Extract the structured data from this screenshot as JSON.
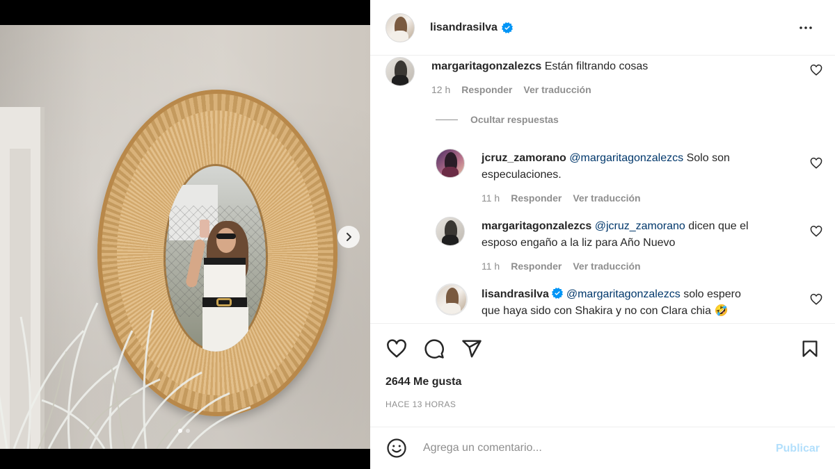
{
  "post": {
    "author": "lisandrasilva",
    "verified": true,
    "carousel": {
      "current_slide": 1,
      "total_slides": 2
    }
  },
  "comments": [
    {
      "username": "margaritagonzalezcs",
      "text": "Están filtrando cosas",
      "time": "12 h",
      "reply_label": "Responder",
      "translate_label": "Ver traducción"
    }
  ],
  "replies_toggle": "Ocultar respuestas",
  "replies": [
    {
      "username": "jcruz_zamorano",
      "mention": "@margaritagonzalezcs",
      "text_line1": "Solo son",
      "text_line2": "especulaciones.",
      "time": "11 h",
      "reply_label": "Responder",
      "translate_label": "Ver traducción"
    },
    {
      "username": "margaritagonzalezcs",
      "mention": "@jcruz_zamorano",
      "text_line1": "dicen que el",
      "text_line2": "esposo engaño a la liz para Año Nuevo",
      "time": "11 h",
      "reply_label": "Responder",
      "translate_label": "Ver traducción"
    },
    {
      "username": "lisandrasilva",
      "verified": true,
      "mention": "@margaritagonzalezcs",
      "text_line1": "solo espero",
      "text_line2": "que haya sido con Shakira y no con Clara chia",
      "emoji": "🤣"
    }
  ],
  "engagement": {
    "likes": "2644 Me gusta",
    "timestamp": "HACE 13 HORAS"
  },
  "compose": {
    "placeholder": "Agrega un comentario...",
    "publish_label": "Publicar"
  },
  "colors": {
    "link": "#00376b",
    "verified": "#0095f6",
    "muted": "#8e8e8e",
    "publish_disabled": "#b2dffc"
  },
  "icons": [
    "verified-badge-icon",
    "more-options-icon",
    "heart-icon",
    "comment-icon",
    "share-icon",
    "bookmark-icon",
    "emoji-icon",
    "chevron-right-icon"
  ]
}
